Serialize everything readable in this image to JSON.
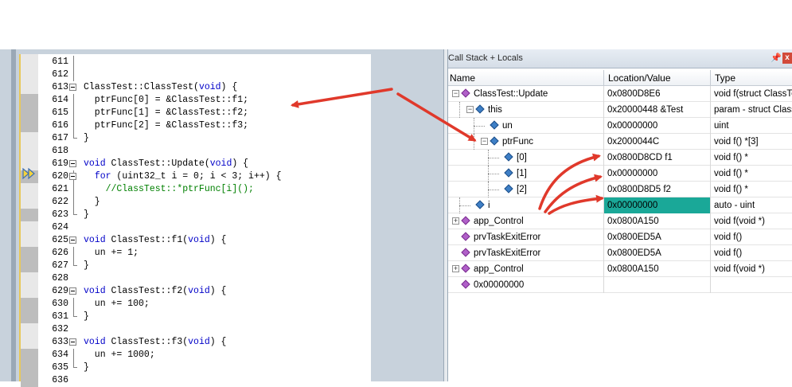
{
  "editor": {
    "lines": [
      {
        "n": "611",
        "text": ""
      },
      {
        "n": "612",
        "text": ""
      },
      {
        "n": "613",
        "text": "ClassTest::ClassTest(void) {"
      },
      {
        "n": "614",
        "text": "  ptrFunc[0] = &ClassTest::f1;"
      },
      {
        "n": "615",
        "text": "  ptrFunc[1] = &ClassTest::f2;"
      },
      {
        "n": "616",
        "text": "  ptrFunc[2] = &ClassTest::f3;"
      },
      {
        "n": "617",
        "text": "}"
      },
      {
        "n": "618",
        "text": ""
      },
      {
        "n": "619",
        "text": "void ClassTest::Update(void) {"
      },
      {
        "n": "620",
        "text": "  for (uint32_t i = 0; i < 3; i++) {"
      },
      {
        "n": "621",
        "text": "    //ClassTest::*ptrFunc[i]();"
      },
      {
        "n": "622",
        "text": "  }"
      },
      {
        "n": "623",
        "text": "}"
      },
      {
        "n": "624",
        "text": ""
      },
      {
        "n": "625",
        "text": "void ClassTest::f1(void) {"
      },
      {
        "n": "626",
        "text": "  un += 1;"
      },
      {
        "n": "627",
        "text": "}"
      },
      {
        "n": "628",
        "text": ""
      },
      {
        "n": "629",
        "text": "void ClassTest::f2(void) {"
      },
      {
        "n": "630",
        "text": "  un += 100;"
      },
      {
        "n": "631",
        "text": "}"
      },
      {
        "n": "632",
        "text": ""
      },
      {
        "n": "633",
        "text": "void ClassTest::f3(void) {"
      },
      {
        "n": "634",
        "text": "  un += 1000;"
      },
      {
        "n": "635",
        "text": "}"
      },
      {
        "n": "636",
        "text": ""
      }
    ]
  },
  "panel": {
    "title": "Call Stack + Locals",
    "pin_icon": "pin-icon",
    "close_icon": "close-icon",
    "columns": [
      "Name",
      "Location/Value",
      "Type"
    ],
    "rows": [
      {
        "name": "ClassTest::Update",
        "value": "0x0800D8E6",
        "type": "void f(struct ClassTest *)",
        "icon": "function-icon",
        "expander": "-"
      },
      {
        "name": "this",
        "value": "0x20000448 &Test",
        "type": "param - struct ClassTest *",
        "icon": "pointer-icon",
        "expander": "-"
      },
      {
        "name": "un",
        "value": "0x00000000",
        "type": "uint",
        "icon": "variable-icon",
        "expander": ""
      },
      {
        "name": "ptrFunc",
        "value": "0x2000044C",
        "type": "void f()  *[3]",
        "icon": "array-icon",
        "expander": "-"
      },
      {
        "name": "[0]",
        "value": "0x0800D8CD f1",
        "type": "void f()  *",
        "icon": "variable-icon",
        "expander": ""
      },
      {
        "name": "[1]",
        "value": "0x00000000",
        "type": "void f()  *",
        "icon": "variable-icon",
        "expander": ""
      },
      {
        "name": "[2]",
        "value": "0x0800D8D5 f2",
        "type": "void f()  *",
        "icon": "variable-icon",
        "expander": ""
      },
      {
        "name": "i",
        "value": "0x00000000",
        "type": "auto - uint",
        "icon": "variable-icon",
        "expander": "",
        "highlight": true
      },
      {
        "name": "app_Control",
        "value": "0x0800A150",
        "type": "void f(void *)",
        "icon": "function-icon",
        "expander": "+"
      },
      {
        "name": "prvTaskExitError",
        "value": "0x0800ED5A",
        "type": "void f()",
        "icon": "function-icon",
        "expander": ""
      },
      {
        "name": "prvTaskExitError",
        "value": "0x0800ED5A",
        "type": "void f()",
        "icon": "function-icon",
        "expander": ""
      },
      {
        "name": "app_Control",
        "value": "0x0800A150",
        "type": "void f(void *)",
        "icon": "function-icon",
        "expander": "+"
      },
      {
        "name": "0x00000000",
        "value": "",
        "type": "",
        "icon": "function-icon",
        "expander": ""
      }
    ],
    "highlight_color": "#1aa898"
  },
  "annotations": {
    "arrow_color": "#e0392b"
  }
}
